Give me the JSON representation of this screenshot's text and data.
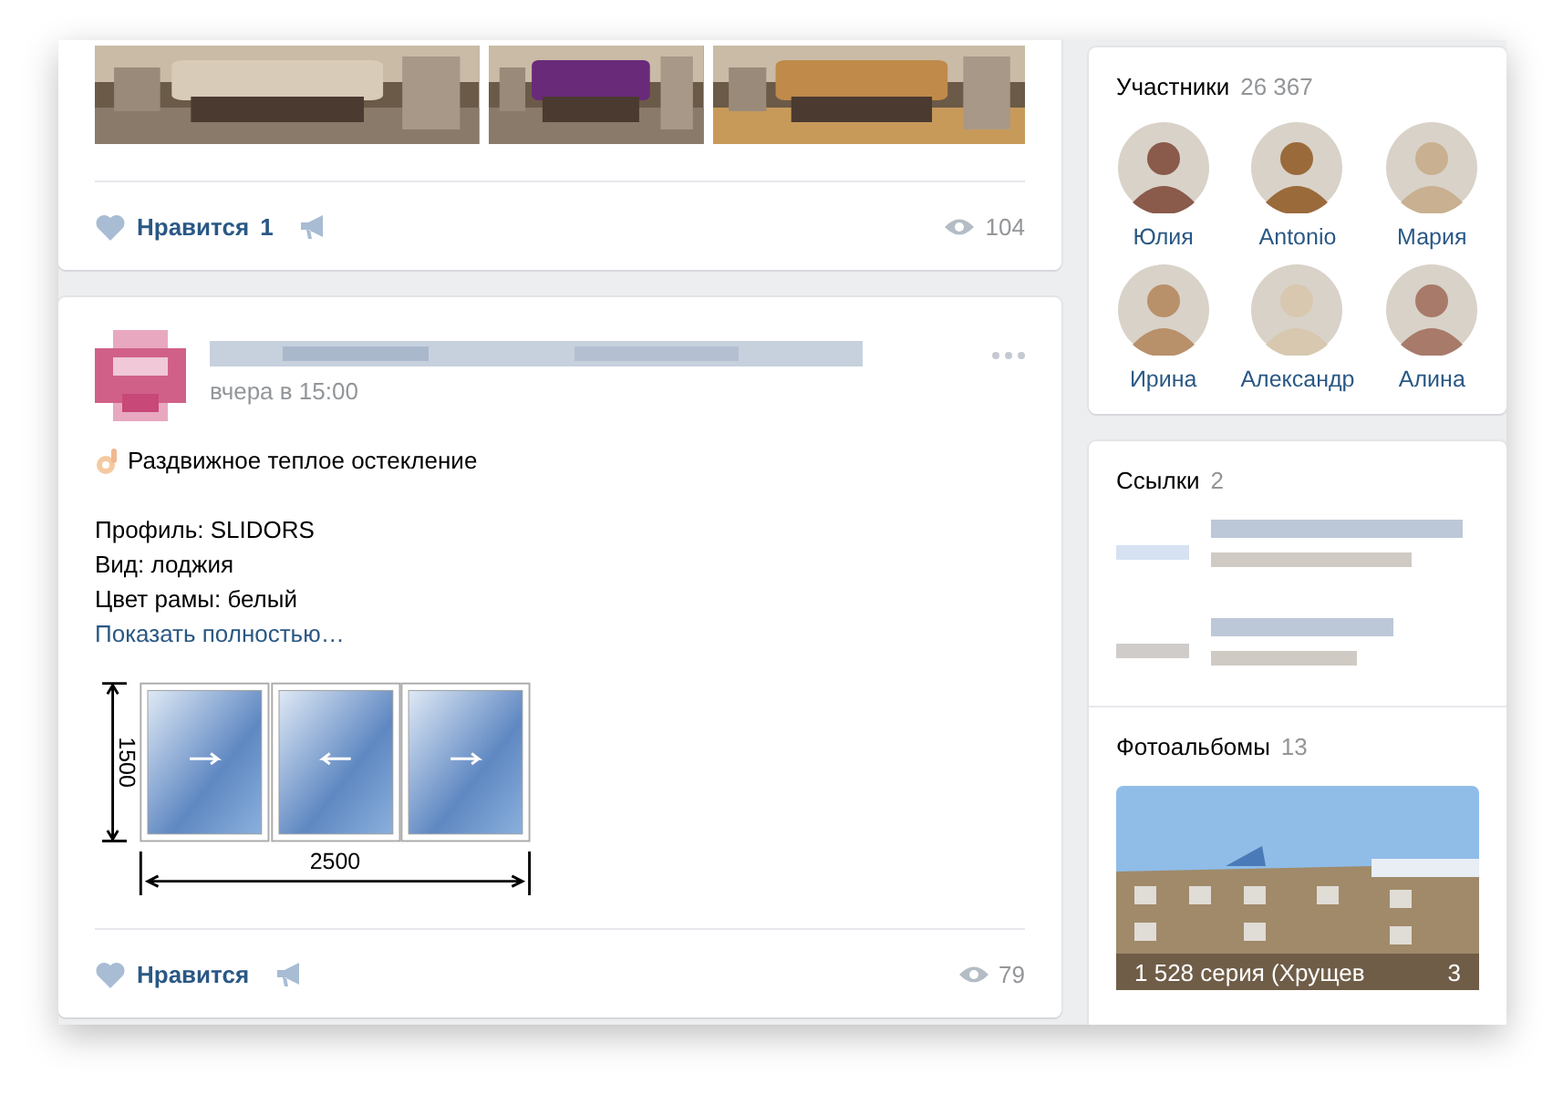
{
  "feed": [
    {
      "kind": "photos",
      "like_label": "Нравится",
      "like_count": "1",
      "views": "104"
    },
    {
      "kind": "text",
      "time": "вчера в 15:00",
      "headline": "Раздвижное теплое остекление",
      "details": [
        "Профиль: SLIDORS",
        "Вид: лоджия",
        "Цвет рамы: белый"
      ],
      "more_link": "Показать полностью…",
      "diagram": {
        "height_label": "1500",
        "width_label": "2500"
      },
      "like_label": "Нравится",
      "views": "79"
    }
  ],
  "members": {
    "title": "Участники",
    "count": "26 367",
    "people": [
      {
        "name": "Юлия"
      },
      {
        "name": "Antonio"
      },
      {
        "name": "Мария"
      },
      {
        "name": "Ирина"
      },
      {
        "name": "Александр"
      },
      {
        "name": "Алина"
      }
    ]
  },
  "links": {
    "title": "Ссылки",
    "count": "2",
    "items": [
      {
        "kind": "link"
      },
      {
        "kind": "link"
      }
    ]
  },
  "albums": {
    "title": "Фотоальбомы",
    "count": "13",
    "cover": {
      "kind": "picture",
      "caption": "1 528 серия (Хрущев",
      "photos": "3"
    }
  }
}
